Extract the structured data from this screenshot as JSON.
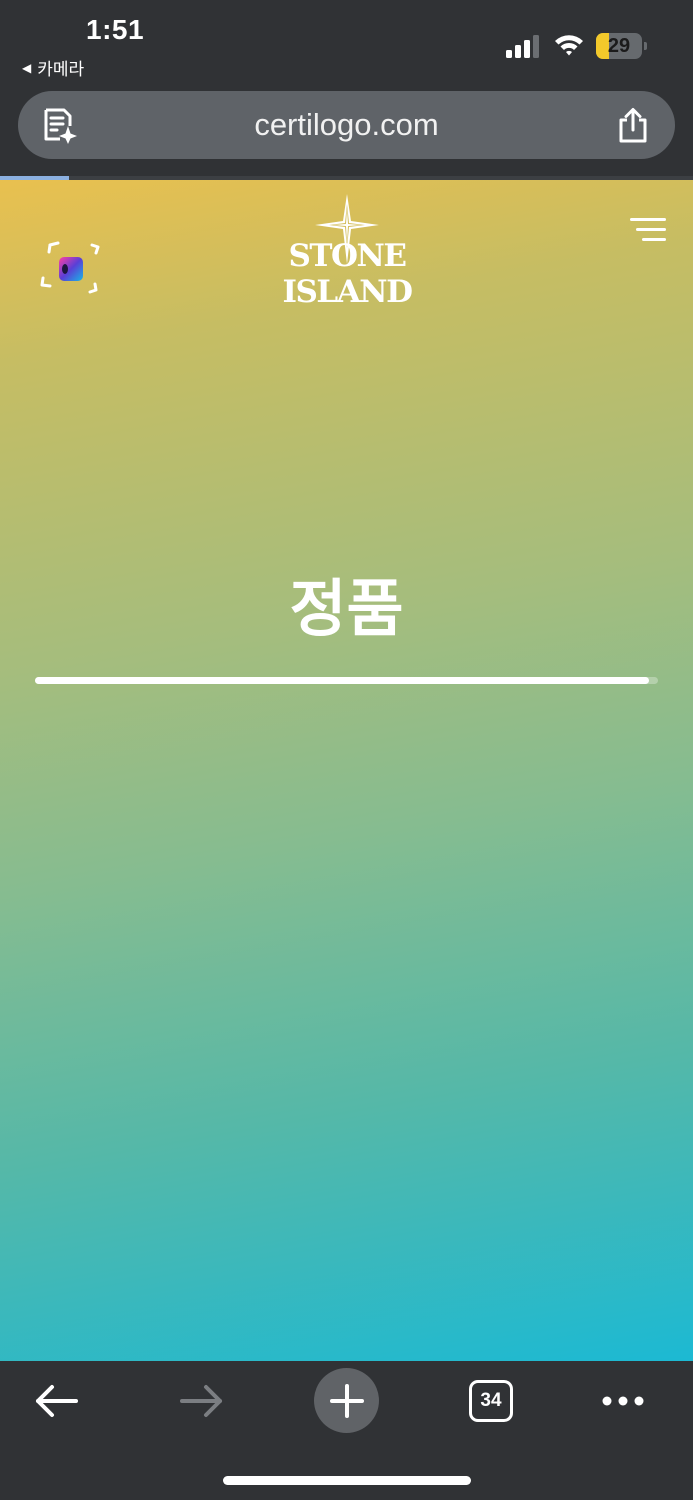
{
  "status_bar": {
    "time": "1:51",
    "back_app": "카메라",
    "battery_level": "29",
    "battery_fraction": 0.29,
    "cellular_bars_active": 3,
    "cellular_bars_total": 4,
    "wifi": "wifi-icon"
  },
  "browser": {
    "url": "certilogo.com",
    "reader_icon": "reader-summary-icon",
    "share_icon": "share-icon",
    "load_progress": 0.1
  },
  "page": {
    "brand": "STONE ISLAND",
    "verdict": "정품",
    "verdict_bar_fraction": 0.985,
    "gradient_colors": [
      "#e9c04f",
      "#a5bd7d",
      "#1cb9d3"
    ],
    "scan_icon": "scan-icon",
    "menu_icon": "menu-icon"
  },
  "toolbar": {
    "back_icon": "arrow-left-icon",
    "forward_icon": "arrow-right-icon",
    "new_tab_icon": "plus-icon",
    "tab_count": "34",
    "more_icon": "more-icon"
  }
}
